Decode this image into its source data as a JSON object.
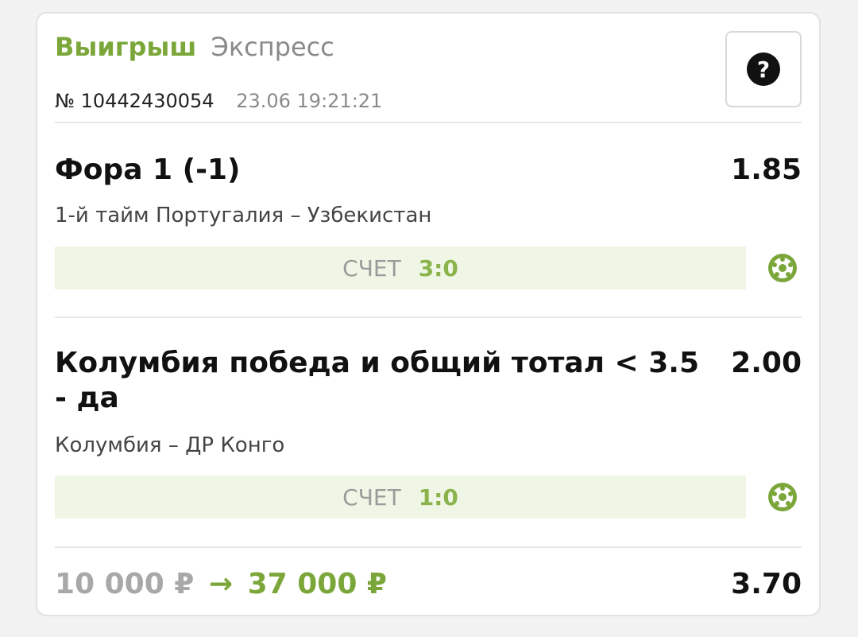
{
  "header": {
    "status": "Выигрыш",
    "type": "Экспресс",
    "ticket_number": "№ 10442430054",
    "timestamp": "23.06 19:21:21",
    "help_label": "?"
  },
  "bets": [
    {
      "name": "Фора 1 (-1)",
      "odds": "1.85",
      "match": "1-й тайм Португалия – Узбекистан",
      "score_label": "СЧЕТ",
      "score": "3:0",
      "sport_icon": "soccer-ball-icon"
    },
    {
      "name": "Колумбия победа и общий тотал < 3.5 - да",
      "odds": "2.00",
      "match": "Колумбия – ДР Конго",
      "score_label": "СЧЕТ",
      "score": "1:0",
      "sport_icon": "soccer-ball-icon"
    }
  ],
  "footer": {
    "stake": "10 000 ₽",
    "arrow": "→",
    "payout": "37 000 ₽",
    "total_odds": "3.70"
  },
  "colors": {
    "accent_green": "#7ba73a",
    "score_bg": "#f0f6e6",
    "muted_gray": "#8a8a8a"
  }
}
